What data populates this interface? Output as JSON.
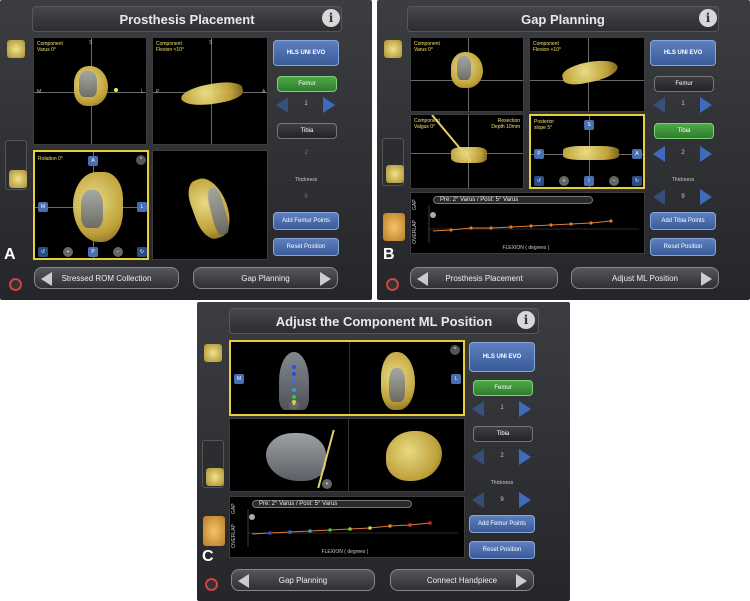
{
  "panelA": {
    "title": "Prosthesis Placement",
    "letter": "A",
    "views": {
      "tl": "Component\nVarus 0°",
      "tr": "Component\nFlexion <10°",
      "bl": "Rotation 0°"
    },
    "axes": {
      "S": "S",
      "M": "M",
      "L": "L",
      "P": "P",
      "A": "A"
    },
    "implant_button": "HLS UNI EVO",
    "femur_button": "Femur",
    "femur_value": "1",
    "tibia_button": "Tibia",
    "tibia_value": "2",
    "thickness_label": "Thickness",
    "thickness_value": "9",
    "add_points_button": "Add Femur Points",
    "reset_button": "Reset Position",
    "nav_back": "Stressed ROM Collection",
    "nav_forward": "Gap Planning"
  },
  "panelB": {
    "title": "Gap Planning",
    "letter": "B",
    "views": {
      "tl": "Component\nVarus 0°",
      "tr": "Component\nFlexion +10°",
      "bl": "Component\nValgus 0°",
      "bl_right": "Resection\nDepth 10mm",
      "br": "Posterior\nslope 5°"
    },
    "implant_button": "HLS UNI EVO",
    "femur_button": "Femur",
    "femur_value": "1",
    "tibia_button": "Tibia",
    "tibia_value": "2",
    "thickness_label": "Thickness",
    "thickness_value": "9",
    "add_points_button": "Add Tibia Points",
    "reset_button": "Reset Position",
    "graph_label": "Pre: 2° Varus / Post: 5° Varus",
    "graph_xlabel": "FLEXION  ( degrees )",
    "graph_ylabel_top": "GAP",
    "graph_ylabel_bottom": "OVERLAP",
    "nav_back": "Prosthesis Placement",
    "nav_forward": "Adjust ML Position"
  },
  "panelC": {
    "title": "Adjust the Component ML Position",
    "letter": "C",
    "implant_button": "HLS UNI EVO",
    "femur_button": "Femur",
    "femur_value": "1",
    "tibia_button": "Tibia",
    "tibia_value": "2",
    "thickness_label": "Thickness",
    "thickness_value": "9",
    "add_points_button": "Add Femur Points",
    "reset_button": "Reset Position",
    "graph_label": "Pre: 2° Varus / Post: 5° Varus",
    "graph_xlabel": "FLEXION  ( degrees )",
    "graph_ylabel_top": "GAP",
    "graph_ylabel_bottom": "OVERLAP",
    "nav_back": "Gap Planning",
    "nav_forward": "Connect Handpiece"
  },
  "icons": [
    "info-icon",
    "knee-icon",
    "power-icon",
    "arrow-left-icon",
    "arrow-right-icon",
    "chevron-up-icon"
  ],
  "colors": {
    "accent_blue": "#3e6bc0",
    "selected_green": "#3f9a3b",
    "highlight_yellow": "#e8cf3a",
    "bone": "#e5cf66"
  }
}
